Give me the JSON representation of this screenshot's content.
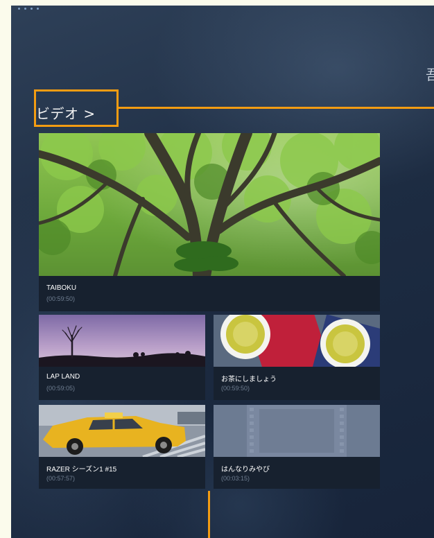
{
  "app": {
    "section_title": "ビデオ >",
    "edge_text": "吾"
  },
  "videos": [
    {
      "title": "TAIBOKU",
      "duration": "(00:59:50)",
      "thumb_icon": "tree-canopy-thumbnail"
    },
    {
      "title": "LAP LAND",
      "duration": "(00:59:05)",
      "thumb_icon": "purple-sky-tree-thumbnail"
    },
    {
      "title": "お茶にしましょう",
      "duration": "(00:59:50)",
      "thumb_icon": "green-tea-cups-thumbnail"
    },
    {
      "title": "RAZER シーズン1  #15",
      "duration": "(00:57:57)",
      "thumb_icon": "yellow-taxi-thumbnail"
    },
    {
      "title": "はんなりみやび",
      "duration": "(00:03:15)",
      "thumb_icon": "film-placeholder-thumbnail"
    }
  ],
  "colors": {
    "highlight": "#f39c12",
    "background": "#1d2c42",
    "tile": "#17212f"
  }
}
